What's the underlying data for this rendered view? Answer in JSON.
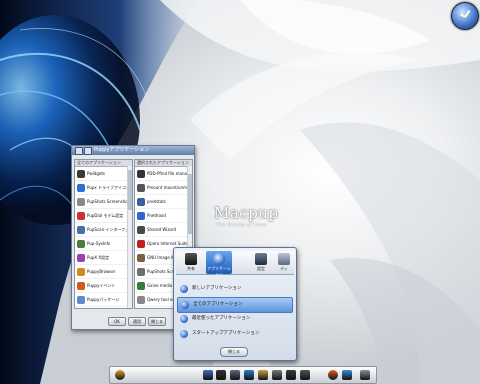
{
  "desktop": {
    "brand": "Macpup",
    "tagline": "The Beauty of Linux"
  },
  "app_window": {
    "title": "Puppyアプリケーション",
    "left_header": "全てのアプリケーション",
    "right_header": "選択されたアプリケーション",
    "left_items": [
      {
        "label": "Pwidgets",
        "color": "#3a3a3a"
      },
      {
        "label": "Pupx ドライブアイコン",
        "color": "#2b6fd0"
      },
      {
        "label": "PupShots Screenshot",
        "color": "#8a8a8a"
      },
      {
        "label": "PupDial モデム設定",
        "color": "#c83232"
      },
      {
        "label": "PupScan インターフェース",
        "color": "#4a6fa8"
      },
      {
        "label": "Pup-SysInfo",
        "color": "#4d7d3a"
      },
      {
        "label": "PupX X設定",
        "color": "#9c3fb0"
      },
      {
        "label": "PuppyBrowser",
        "color": "#d08a20"
      },
      {
        "label": "Puppyイベント",
        "color": "#d05a20"
      },
      {
        "label": "Puppyパッケージ",
        "color": "#5a8ad0"
      },
      {
        "label": "Puppyボッチーニ",
        "color": "#e2b010"
      },
      {
        "label": "Puppyユニバース",
        "color": "#3090d0"
      },
      {
        "label": "Puppyライブ",
        "color": "#e0c020"
      }
    ],
    "right_items": [
      {
        "label": "PDD-Pfind file manager",
        "color": "#333333"
      },
      {
        "label": "Pmount mount/unmount",
        "color": "#555555"
      },
      {
        "label": "pnetstats",
        "color": "#3a5fa0"
      },
      {
        "label": "Pnethood",
        "color": "#2d6ac8"
      },
      {
        "label": "Shared Wizard",
        "color": "#4a4a4a"
      },
      {
        "label": "Opera Internet Suite",
        "color": "#c02020"
      },
      {
        "label": "GNU Image Manipulation",
        "color": "#7a6040"
      },
      {
        "label": "PupShots Screenshot",
        "color": "#707070"
      },
      {
        "label": "Gxine media player",
        "color": "#3a7a3a"
      },
      {
        "label": "Qwery tool editor",
        "color": "#888888"
      },
      {
        "label": "wvd",
        "color": "#3060a0"
      }
    ],
    "buttons": [
      "OK",
      "適用",
      "閉じる"
    ]
  },
  "menu_panel": {
    "tabs": [
      {
        "label": "共有",
        "icon": "share-icon",
        "active": false
      },
      {
        "label": "アプリケーション",
        "icon": "play-icon",
        "active": true
      },
      {
        "label": "設定",
        "icon": "monitor-icon",
        "active": false
      },
      {
        "label": "ディ",
        "icon": "display-icon",
        "active": false
      }
    ],
    "items": [
      {
        "label": "新しいアプリケーション",
        "selected": false
      },
      {
        "label": "全てのアプリケーション",
        "selected": true
      },
      {
        "label": "最近使ったアプリケーション",
        "selected": false
      },
      {
        "label": "スタートアップアプリケーション",
        "selected": false
      }
    ],
    "close_label": "閉じる"
  },
  "dock": {
    "icons": [
      "home-icon",
      "apps-icon",
      "terminal-icon",
      "monitor-icon",
      "network-icon",
      "folder-icon",
      "printer-icon",
      "media-icon",
      "camera-icon",
      "firefox-icon",
      "mail-icon",
      "trash-icon"
    ]
  }
}
